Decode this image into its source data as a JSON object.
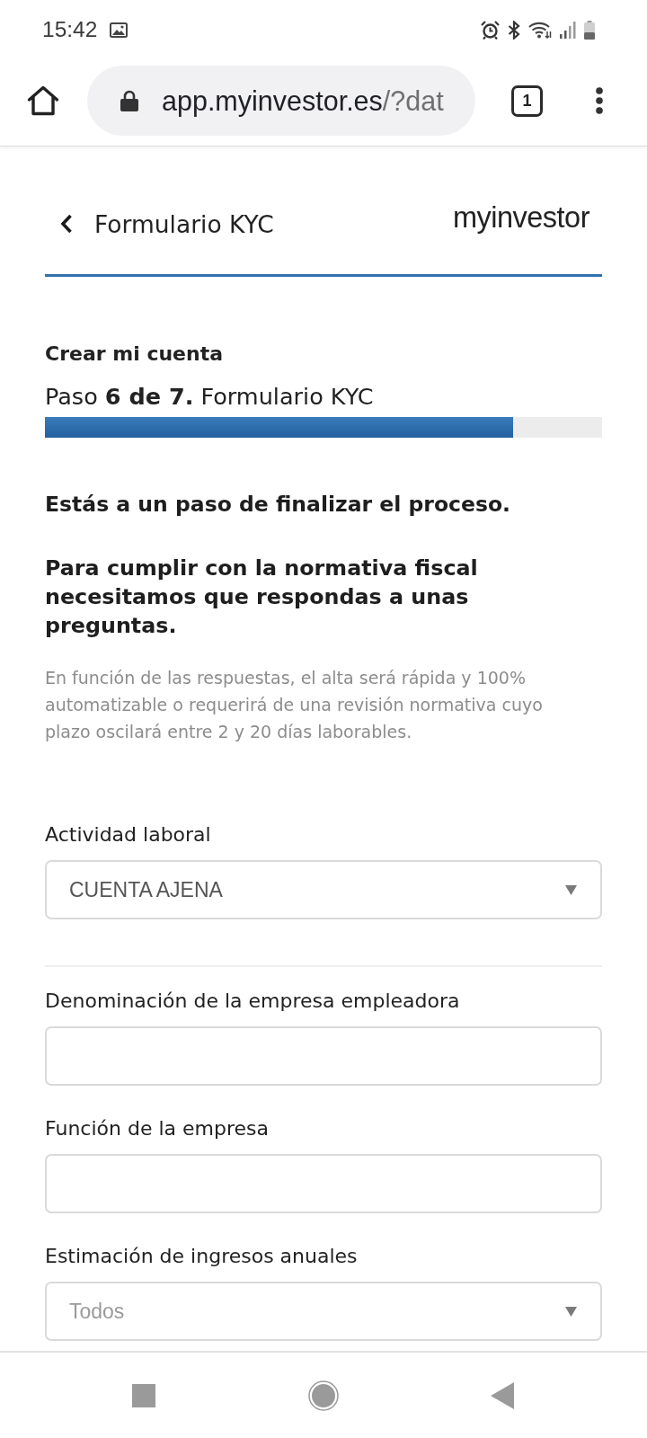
{
  "status_bar": {
    "time": "15:42"
  },
  "browser": {
    "url_host": "app.myinvestor.es",
    "url_path": "/?dat",
    "tab_count": "1"
  },
  "header": {
    "title": "Formulario KYC",
    "logo": "myinvestor"
  },
  "progress": {
    "heading": "Crear mi cuenta",
    "step": "Paso **6 de 7.** Formulario KYC",
    "level": 0.84
  },
  "intro": {
    "lead": "Estás a un paso de finalizar el proceso.",
    "heading": "Para cumplir con la normativa fiscal necesitamos que respondas a unas preguntas.",
    "note": "En función de las respuestas, el alta será rápida y 100% automatizable o requerirá de una revisión normativa cuyo plazo oscilará entre 2 y 20 días laborables."
  },
  "form": {
    "sections": [
      [
        {
          "kind": "select",
          "label": "Actividad laboral",
          "value": "CUENTA AJENA"
        }
      ],
      [
        {
          "kind": "text",
          "label": "Denominación de la empresa empleadora"
        },
        {
          "kind": "text",
          "label": "Función de la empresa"
        },
        {
          "kind": "select",
          "label": "Estimación de ingresos anuales",
          "placeholder": "Todos"
        }
      ]
    ]
  }
}
